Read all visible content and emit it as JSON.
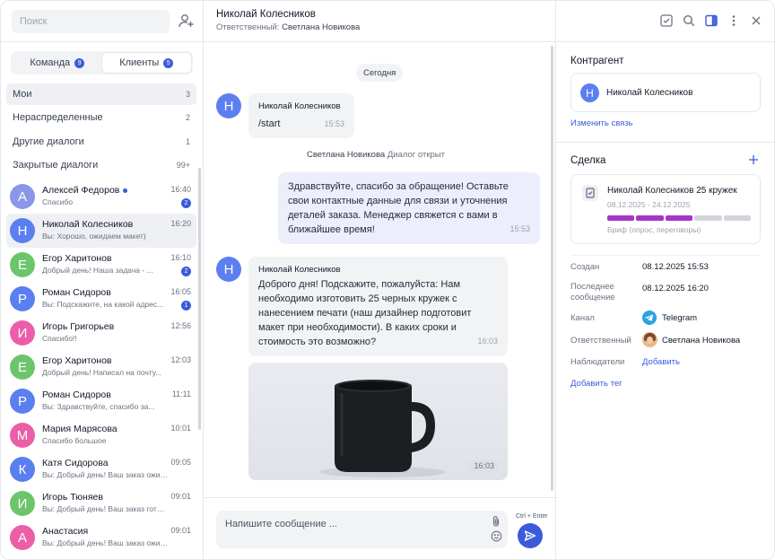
{
  "sidebar": {
    "search_placeholder": "Поиск",
    "tabs": [
      {
        "label": "Команда",
        "count": "9"
      },
      {
        "label": "Клиенты",
        "count": "5"
      }
    ],
    "categories": [
      {
        "label": "Мои",
        "count": "3"
      },
      {
        "label": "Нераспределенные",
        "count": "2"
      },
      {
        "label": "Другие диалоги",
        "count": "1"
      },
      {
        "label": "Закрытые диалоги",
        "count": "99+"
      }
    ],
    "chats": [
      {
        "initial": "А",
        "name": "Алексей Федоров",
        "time": "16:40",
        "preview": "Спасибо",
        "badge": "2",
        "color": "#8c96e8"
      },
      {
        "initial": "Н",
        "name": "Николай Колесников",
        "time": "16:20",
        "preview": "Вы: Хорошо, ожидаем макет)",
        "badge": "",
        "color": "#5b7ff0"
      },
      {
        "initial": "Е",
        "name": "Егор Харитонов",
        "time": "16:10",
        "preview": "Добрый день! Наша задача - ...",
        "badge": "2",
        "color": "#6cc56a"
      },
      {
        "initial": "Р",
        "name": "Роман Сидоров",
        "time": "16:05",
        "preview": "Вы: Подскажите, на какой адрес...",
        "badge": "1",
        "color": "#5b7ff0"
      },
      {
        "initial": "И",
        "name": "Игорь Григорьев",
        "time": "12:56",
        "preview": "Спасибо!!",
        "badge": "",
        "color": "#ec5ea8"
      },
      {
        "initial": "Е",
        "name": "Егор Харитонов",
        "time": "12:03",
        "preview": "Добрый день! Написал на почту...",
        "badge": "",
        "color": "#6cc56a"
      },
      {
        "initial": "Р",
        "name": "Роман Сидоров",
        "time": "11:11",
        "preview": "Вы: Здравствуйте, спасибо за...",
        "badge": "",
        "color": "#5b7ff0"
      },
      {
        "initial": "М",
        "name": "Мария Марясова",
        "time": "10:01",
        "preview": "Спасибо большое",
        "badge": "",
        "color": "#ec5ea8"
      },
      {
        "initial": "К",
        "name": "Катя Сидорова",
        "time": "09:05",
        "preview": "Вы: Добрый день! Ваш заказ ожидает...",
        "badge": "",
        "color": "#5b7ff0"
      },
      {
        "initial": "И",
        "name": "Игорь Тюняев",
        "time": "09:01",
        "preview": "Вы: Добрый день! Ваш заказ готов...",
        "badge": "",
        "color": "#6cc56a"
      },
      {
        "initial": "А",
        "name": "Анастасия",
        "time": "09:01",
        "preview": "Вы: Добрый день! Ваш заказ ожидает...",
        "badge": "",
        "color": "#ec5ea8"
      }
    ]
  },
  "header": {
    "name": "Николай Колесников",
    "responsible_label": "Ответственный:",
    "responsible_name": "Светлана Новикова"
  },
  "conversation": {
    "date": "Сегодня",
    "msg1": {
      "initial": "Н",
      "author": "Николай Колесников",
      "text": "/start",
      "time": "15:53"
    },
    "system": {
      "author": "Светлана Новикова",
      "event": "Диалог открыт"
    },
    "msg2": {
      "text": "Здравствуйте, спасибо за обращение! Оставьте свои контактные данные для связи и уточнения деталей заказа. Менеджер свяжется с вами в ближайшее время!",
      "time": "15:53"
    },
    "msg3": {
      "initial": "Н",
      "author": "Николай Колесников",
      "text": "Доброго дня! Подскажите, пожалуйста: Нам необходимо изготовить 25 черных кружек с нанесением печати (наш дизайнер подготовит макет при необходимости). В каких сроки и стоимость это возможно?",
      "time": "16:03"
    },
    "image_time": "16:03"
  },
  "composer": {
    "placeholder": "Напишите сообщение ...",
    "hint": "Ctrl + Enter"
  },
  "details": {
    "contractor_title": "Контрагент",
    "contractor": {
      "initial": "Н",
      "name": "Николай Колесников"
    },
    "change_link": "Изменить связь",
    "deal_title": "Сделка",
    "deal": {
      "name": "Николай Колесников 25 кружек",
      "dates": "08.12.2025 - 24.12.2025",
      "stage": "Бриф (опрос, переговоры)",
      "progress_filled": 3,
      "progress_total": 5
    },
    "fields": {
      "created_label": "Создан",
      "created_value": "08.12.2025 15:53",
      "last_msg_label": "Последнее сообщение",
      "last_msg_value": "08.12.2025 16:20",
      "channel_label": "Канал",
      "channel_value": "Telegram",
      "responsible_label": "Ответственный",
      "responsible_value": "Светлана Новикова",
      "observers_label": "Наблюдатели",
      "observers_value": "Добавить"
    },
    "add_tag": "Добавить тег"
  },
  "colors": {
    "accent": "#3b5bdb",
    "progress": "#a536c7"
  }
}
